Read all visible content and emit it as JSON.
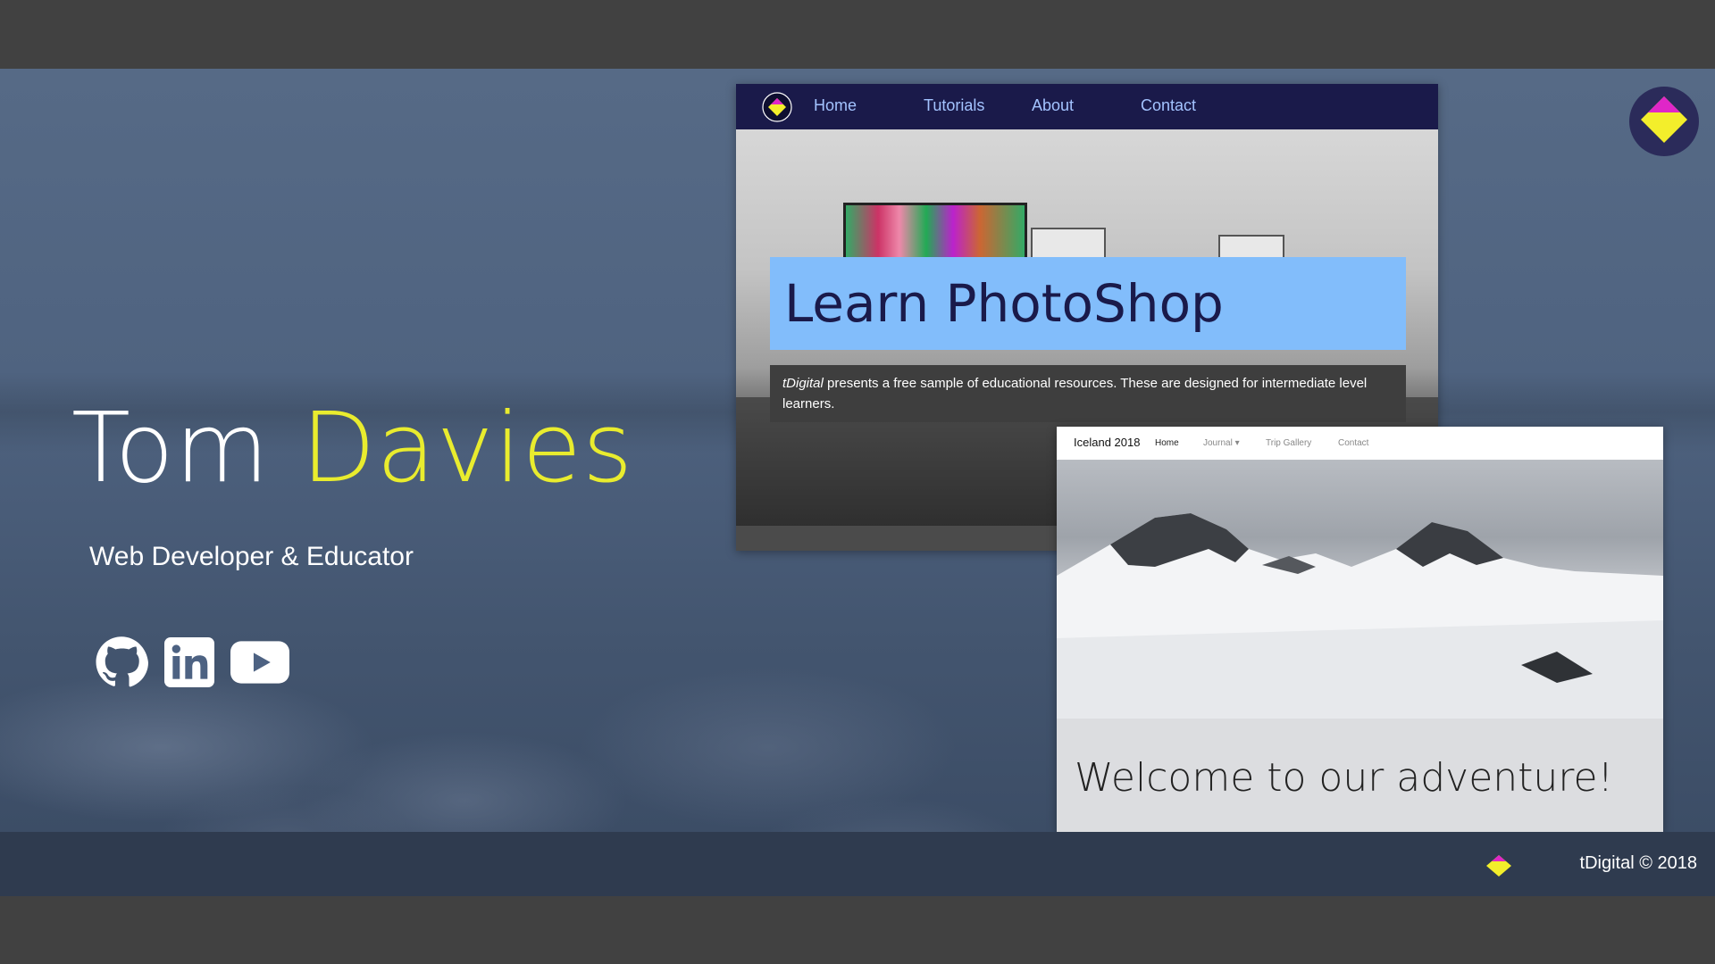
{
  "hero": {
    "first_name": "Tom",
    "last_name": "Davies",
    "tagline": "Web Developer & Educator"
  },
  "socials": [
    {
      "icon": "github-icon"
    },
    {
      "icon": "linkedin-icon"
    },
    {
      "icon": "youtube-icon"
    }
  ],
  "preview_tdigital": {
    "nav": [
      "Home",
      "Tutorials",
      "About",
      "Contact"
    ],
    "heading": "Learn PhotoShop",
    "brand_italic": "tDigital",
    "description": " presents a free sample of educational resources. These are designed for intermediate level learners."
  },
  "preview_iceland": {
    "brand": "Iceland 2018",
    "nav": [
      "Home",
      "Journal",
      "Trip Gallery",
      "Contact"
    ],
    "heading": "Welcome to our adventure!"
  },
  "footer": {
    "copyright": "tDigital © 2018"
  },
  "colors": {
    "accent_yellow": "#e9ec2e",
    "logo_magenta": "#e026c8",
    "nav_dark": "#1a1a4a",
    "heading_blue": "#82bdfb"
  }
}
